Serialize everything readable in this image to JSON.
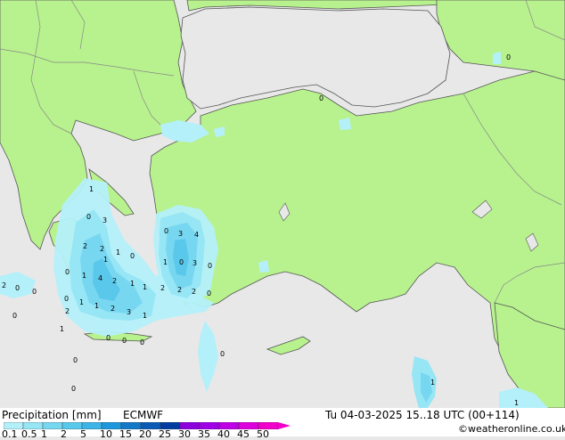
{
  "footer": {
    "title": "Precipitation [mm]",
    "model": "ECMWF",
    "datetime": "Tu 04-03-2025 15..18 UTC (00+114)",
    "credit": "©weatheronline.co.uk"
  },
  "legend": {
    "labels": [
      "0.1",
      "0.5",
      "1",
      "2",
      "5",
      "10",
      "15",
      "20",
      "25",
      "30",
      "35",
      "40",
      "45",
      "50"
    ],
    "colors": [
      "#b4f0fa",
      "#96e6f5",
      "#78d7f0",
      "#5ac8eb",
      "#3cb4e6",
      "#1e96dc",
      "#1478c8",
      "#0a5ab4",
      "#003ca0",
      "#8c00dc",
      "#a000e6",
      "#be00e6",
      "#dc00dc",
      "#f000c8"
    ]
  },
  "map_colors": {
    "land": "#b8f28e",
    "sea": "#e8e8e8",
    "border": "#888888",
    "coast": "#555555"
  },
  "precip_labels": [
    "1",
    "0",
    "3",
    "2",
    "2",
    "1",
    "0",
    "3",
    "4",
    "0",
    "1",
    "1",
    "0",
    "3",
    "0",
    "1",
    "4",
    "2",
    "1",
    "1",
    "2",
    "2",
    "0",
    "1",
    "2",
    "2",
    "1",
    "2",
    "3",
    "1",
    "0",
    "0",
    "1",
    "0",
    "0",
    "0",
    "0",
    "2",
    "0",
    "0",
    "0",
    "0",
    "0",
    "1",
    "0",
    "0",
    "1"
  ]
}
